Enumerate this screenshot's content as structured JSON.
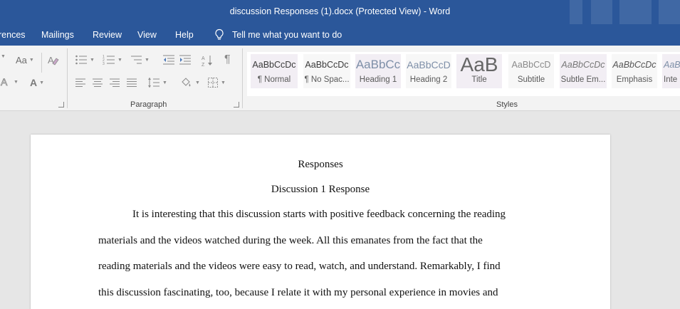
{
  "window": {
    "title": "discussion Responses (1).docx (Protected View)  -  Word"
  },
  "tabs": [
    {
      "label": "rences"
    },
    {
      "label": "Mailings"
    },
    {
      "label": "Review"
    },
    {
      "label": "View"
    },
    {
      "label": "Help"
    }
  ],
  "tell_me": {
    "label": "Tell me what you want to do",
    "icon": "lightbulb-icon"
  },
  "font_group": {
    "font_size_label": "Aa",
    "font_color_label": "A"
  },
  "paragraph_group": {
    "label": "Paragraph"
  },
  "styles_group": {
    "label": "Styles",
    "items": [
      {
        "sample": "AaBbCcDc",
        "name": "¶ Normal"
      },
      {
        "sample": "AaBbCcDc",
        "name": "¶ No Spac..."
      },
      {
        "sample": "AaBbCc",
        "name": "Heading 1"
      },
      {
        "sample": "AaBbCcD",
        "name": "Heading 2"
      },
      {
        "sample": "AaB",
        "name": "Title"
      },
      {
        "sample": "AaBbCcD",
        "name": "Subtitle"
      },
      {
        "sample": "AaBbCcDc",
        "name": "Subtle Em..."
      },
      {
        "sample": "AaBbCcDc",
        "name": "Emphasis"
      },
      {
        "sample": "AaBl",
        "name": "Inte"
      }
    ]
  },
  "document": {
    "heading": "Responses",
    "subheading": "Discussion 1 Response",
    "lines": [
      "It is interesting that this discussion starts with positive feedback concerning the reading",
      "materials and the videos watched during the week. All this emanates from the fact that the",
      "reading materials and the videos were easy to read, watch, and understand. Remarkably, I find",
      "this discussion fascinating, too, because I relate it with my personal experience in movies and"
    ]
  },
  "colors": {
    "title_bar": "#2b579a",
    "ribbon": "#f3f3f3",
    "canvas": "#e6e6e6",
    "page": "#ffffff"
  }
}
